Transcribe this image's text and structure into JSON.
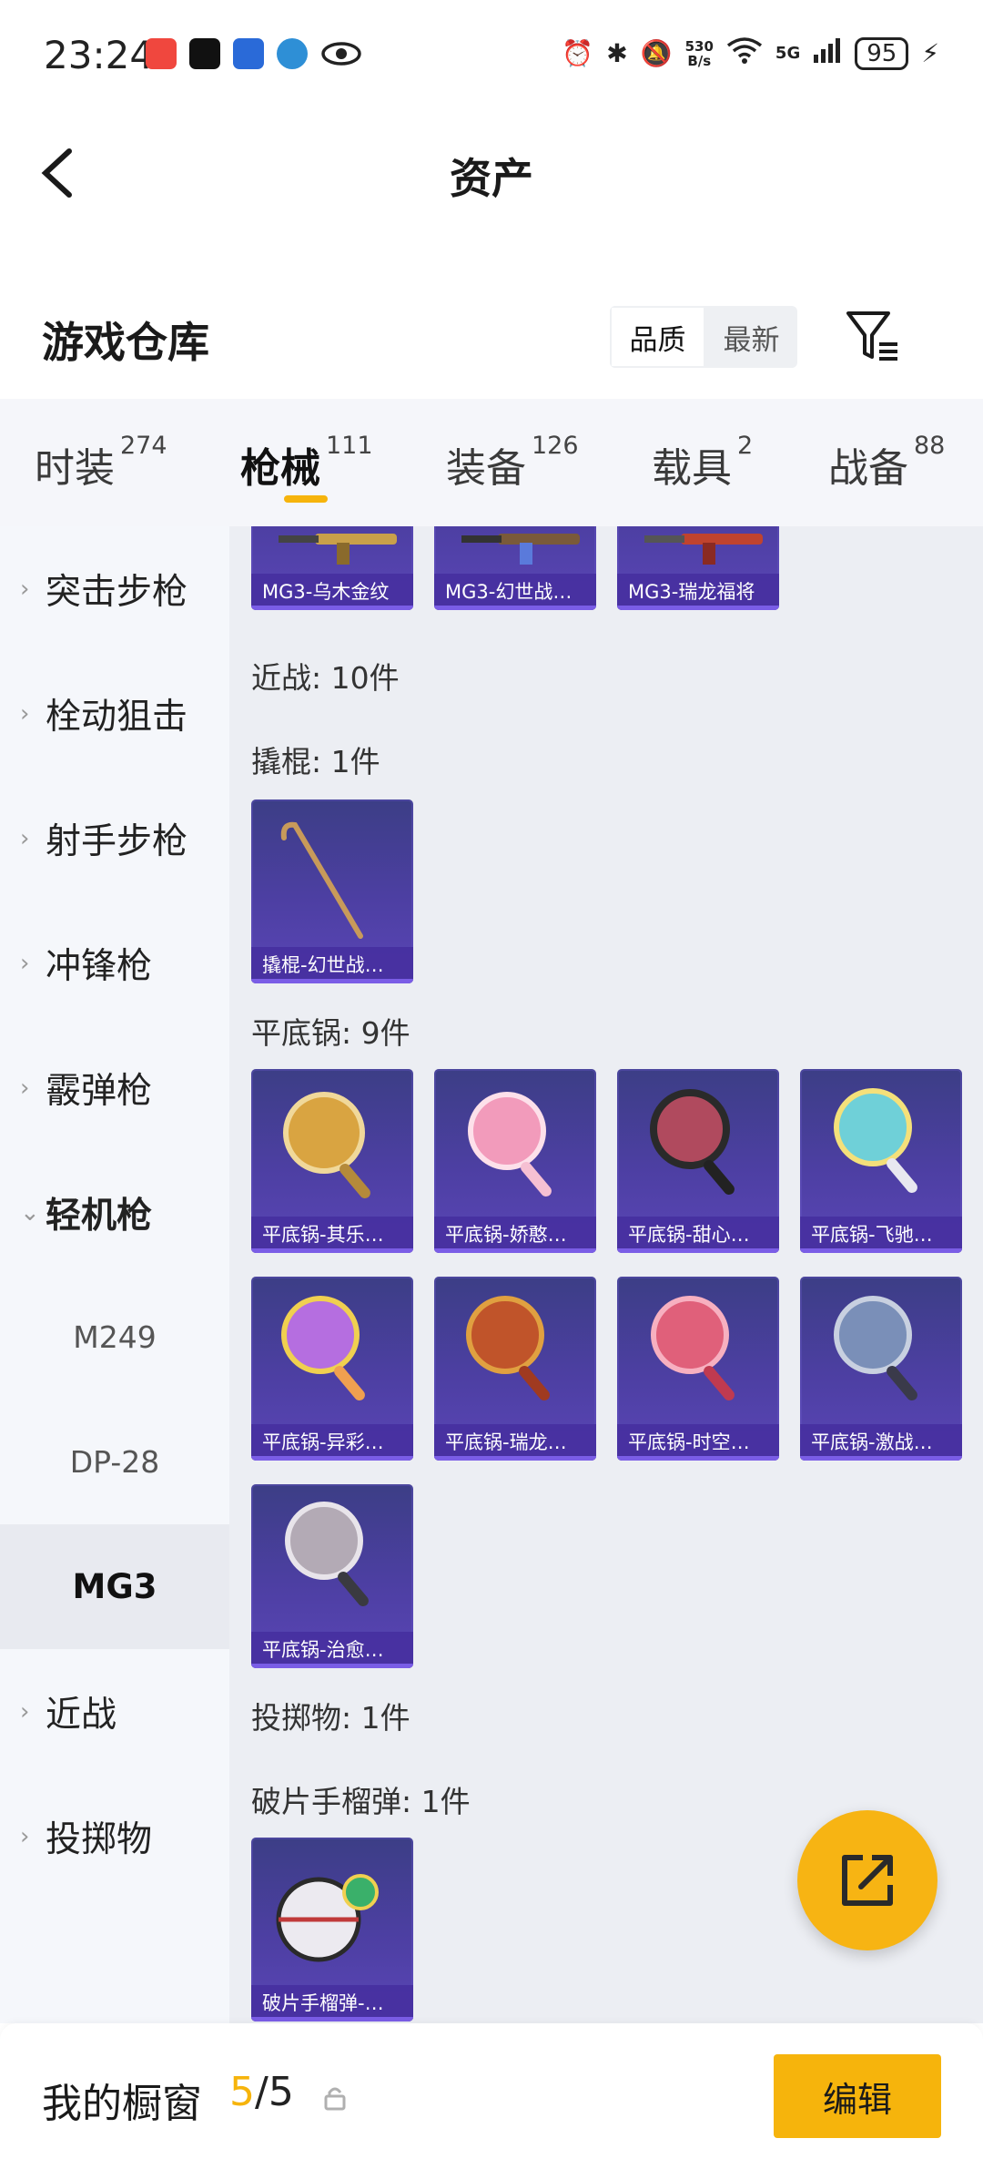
{
  "status_bar": {
    "time": "23:24",
    "net_speed_top": "530",
    "net_speed_bottom": "B/s",
    "signal": "5G",
    "battery": "95"
  },
  "nav": {
    "title": "资产"
  },
  "warehouse": {
    "title": "游戏仓库",
    "sort_quality": "品质",
    "sort_latest": "最新"
  },
  "tabs": [
    {
      "label": "时装",
      "count": "274"
    },
    {
      "label": "枪械",
      "count": "111"
    },
    {
      "label": "装备",
      "count": "126"
    },
    {
      "label": "载具",
      "count": "2"
    },
    {
      "label": "战备",
      "count": "88"
    }
  ],
  "sidebar": {
    "items": [
      {
        "label": "突击步枪"
      },
      {
        "label": "栓动狙击"
      },
      {
        "label": "射手步枪"
      },
      {
        "label": "冲锋枪"
      },
      {
        "label": "霰弹枪"
      },
      {
        "label": "轻机枪"
      },
      {
        "label": "近战"
      },
      {
        "label": "投掷物"
      }
    ],
    "sub_items": [
      {
        "label": "M249"
      },
      {
        "label": "DP-28"
      },
      {
        "label": "MG3"
      }
    ]
  },
  "content": {
    "mg3_cards": [
      {
        "name": "MG3-乌木金纹",
        "icon": "mg3-rifle-icon"
      },
      {
        "name": "MG3-幻世战…",
        "icon": "mg3-rifle-icon"
      },
      {
        "name": "MG3-瑞龙福将",
        "icon": "mg3-rifle-icon"
      }
    ],
    "melee_label": "近战: 10件",
    "crowbar_label": "撬棍: 1件",
    "crowbar_cards": [
      {
        "name": "撬棍-幻世战…",
        "icon": "crowbar-icon"
      }
    ],
    "pan_label": "平底锅: 9件",
    "pan_cards": [
      {
        "name": "平底锅-其乐…",
        "icon": "pan-icon",
        "color": "#d9a441"
      },
      {
        "name": "平底锅-娇憨…",
        "icon": "pan-icon",
        "color": "#f29bbb"
      },
      {
        "name": "平底锅-甜心…",
        "icon": "pan-icon",
        "color": "#b04a5e"
      },
      {
        "name": "平底锅-飞驰…",
        "icon": "pan-icon",
        "color": "#6fd0d8"
      },
      {
        "name": "平底锅-异彩…",
        "icon": "pan-icon",
        "color": "#b56ee0"
      },
      {
        "name": "平底锅-瑞龙…",
        "icon": "pan-icon",
        "color": "#c0542a"
      },
      {
        "name": "平底锅-时空…",
        "icon": "pan-icon",
        "color": "#e0607a"
      },
      {
        "name": "平底锅-激战…",
        "icon": "pan-icon",
        "color": "#7a8fb8"
      },
      {
        "name": "平底锅-治愈…",
        "icon": "pan-icon",
        "color": "#b3aab5"
      }
    ],
    "throwable_label": "投掷物: 1件",
    "grenade_label": "破片手榴弹: 1件",
    "grenade_cards": [
      {
        "name": "破片手榴弹-…",
        "icon": "grenade-icon"
      }
    ]
  },
  "bottom_bar": {
    "title": "我的橱窗",
    "current": "5",
    "separator_total": "/5",
    "edit_label": "编辑"
  },
  "colors": {
    "accent": "#f6b40c",
    "card_bg": "#4d3fa3"
  }
}
